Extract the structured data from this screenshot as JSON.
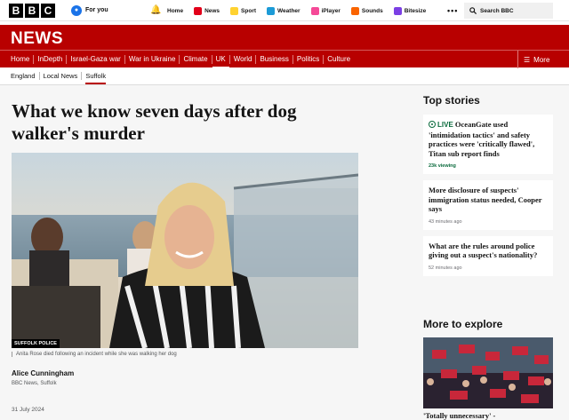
{
  "topbar": {
    "logo_letters": [
      "B",
      "B",
      "C"
    ],
    "foryou_label": "For you",
    "nav": [
      {
        "label": "Home",
        "icon": "none"
      },
      {
        "label": "News",
        "icon": "news-icon",
        "color": "#e2001a"
      },
      {
        "label": "Sport",
        "icon": "sport-icon",
        "color": "#ffd230"
      },
      {
        "label": "Weather",
        "icon": "weather-icon",
        "color": "#1c9bd7"
      },
      {
        "label": "iPlayer",
        "icon": "iplayer-icon",
        "color": "#f54997"
      },
      {
        "label": "Sounds",
        "icon": "sounds-icon",
        "color": "#fa6400"
      },
      {
        "label": "Bitesize",
        "icon": "bitesize-icon",
        "color": "#7b3fe4"
      }
    ],
    "more_label": "•••",
    "search_label": "Search BBC"
  },
  "newsbar": {
    "title": "NEWS"
  },
  "sections": [
    "Home",
    "InDepth",
    "Israel-Gaza war",
    "War in Ukraine",
    "Climate",
    "UK",
    "World",
    "Business",
    "Politics",
    "Culture"
  ],
  "sections_more": "More",
  "subnav": [
    "England",
    "Local News",
    "Suffolk"
  ],
  "article": {
    "headline": "What we know seven days after dog walker's murder",
    "image_badge": "SUFFOLK POLICE",
    "caption": "Anita Rose died following an incident while she was walking her dog",
    "author": "Alice Cunningham",
    "author_role": "BBC News, Suffolk",
    "date": "31 July 2024"
  },
  "sidebar": {
    "heading": "Top stories",
    "stories": [
      {
        "live": "LIVE",
        "title": "OceanGate used 'intimidation tactics' and safety practices were 'critically flawed', Titan sub report finds",
        "meta": "23k viewing"
      },
      {
        "title": "More disclosure of suspects' immigration status needed, Cooper says",
        "meta": "43 minutes ago"
      },
      {
        "title": "What are the rules around police giving out a suspect's nationality?",
        "meta": "52 minutes ago"
      }
    ],
    "explore_heading": "More to explore",
    "explore_caption": "'Totally unnecessary' -"
  },
  "colors": {
    "brand_red": "#b80000",
    "live_green": "#0a6a3c"
  }
}
